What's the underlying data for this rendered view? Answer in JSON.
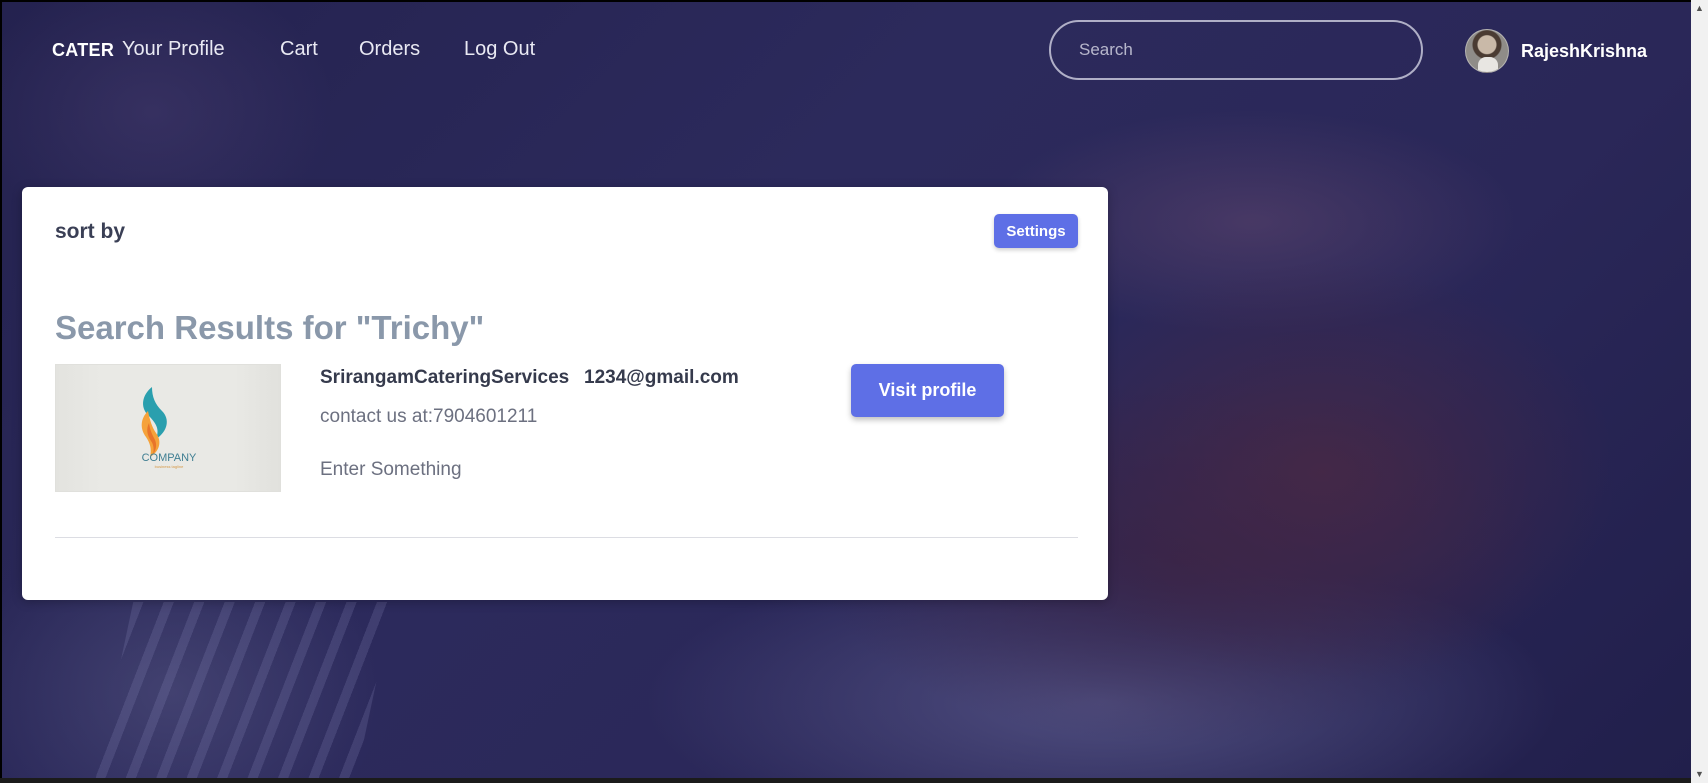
{
  "nav": {
    "brand": "CATER",
    "links": [
      "Your Profile",
      "Cart",
      "Orders",
      "Log Out"
    ],
    "search_placeholder": "Search",
    "username": "RajeshKrishna"
  },
  "card": {
    "sort_label": "sort by",
    "settings_label": "Settings",
    "results_title": "Search Results for \"Trichy\"",
    "result": {
      "name": "SrirangamCateringServices",
      "email": "1234@gmail.com",
      "contact": "contact us at:7904601211",
      "description": "Enter Something",
      "visit_label": "Visit profile",
      "logo_text": "COMPANY",
      "logo_tagline": "business tagline"
    }
  },
  "colors": {
    "accent": "#5e6fe6",
    "background": "#2a2758",
    "title_gray": "#8a98aa"
  }
}
